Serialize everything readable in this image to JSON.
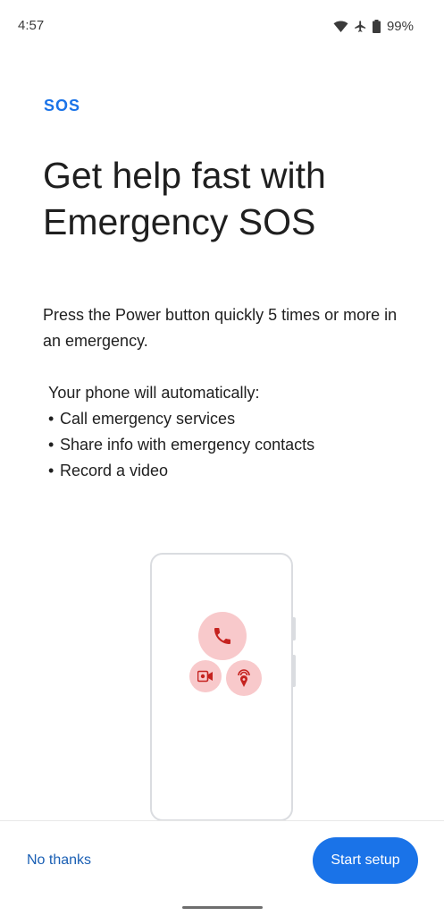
{
  "status_bar": {
    "time": "4:57",
    "battery_percent": "99%",
    "icons": [
      "wifi-icon",
      "airplane-icon",
      "battery-icon"
    ]
  },
  "header": {
    "sos_label": "SOS"
  },
  "main": {
    "title": "Get help fast with Emergency SOS",
    "description": "Press the Power button quickly 5 times or more in an emergency.",
    "auto_intro": "Your phone will automatically:",
    "auto_items": [
      "Call emergency services",
      "Share info with emergency contacts",
      "Record a video"
    ]
  },
  "illustration": {
    "icons": [
      "phone-call-icon",
      "video-record-icon",
      "location-share-icon"
    ]
  },
  "footer": {
    "no_thanks_label": "No thanks",
    "start_setup_label": "Start setup"
  },
  "colors": {
    "accent": "#1a73e8",
    "sos_circle": "#f8c9cb",
    "sos_icon": "#c5221f"
  }
}
